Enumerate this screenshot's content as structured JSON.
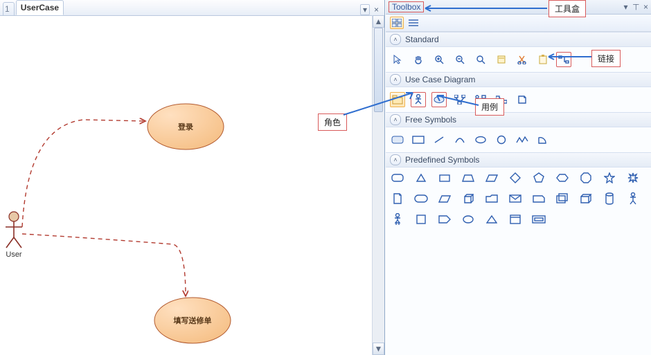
{
  "editor": {
    "tab_stub": "1",
    "active_tab": "UserCase",
    "dropdown_glyph": "▾",
    "close_glyph": "×"
  },
  "canvas": {
    "actor_label": "User",
    "usecase1": "登录",
    "usecase2": "填写送修单"
  },
  "toolbox": {
    "title": "Toolbox",
    "controls": {
      "menu": "▾",
      "pin": "⊥",
      "close": "×"
    },
    "sections": {
      "standard": "Standard",
      "usecase": "Use Case Diagram",
      "free": "Free Symbols",
      "predefined": "Predefined Symbols"
    }
  },
  "annotations": {
    "role": "角色",
    "usecase": "用例",
    "toolbox": "工具盒",
    "link": "链接"
  }
}
